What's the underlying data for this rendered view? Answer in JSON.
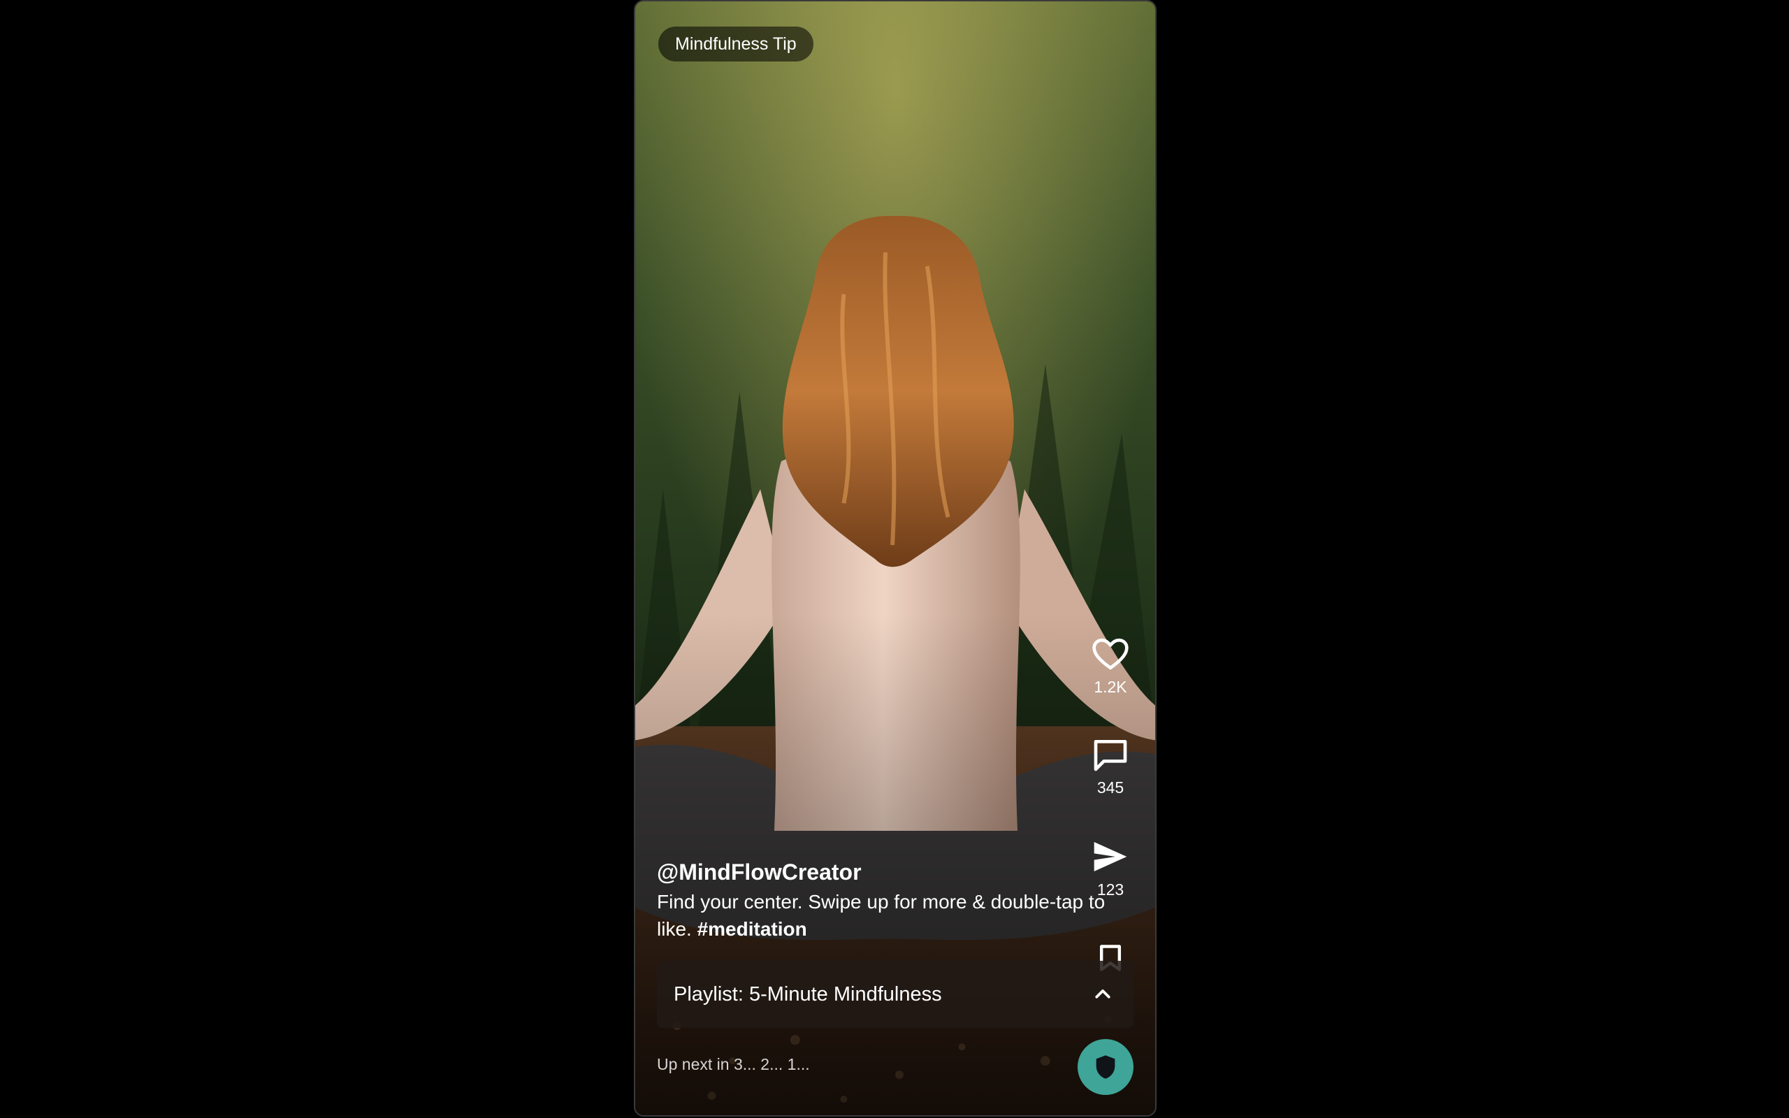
{
  "badge": "Mindfulness Tip",
  "post": {
    "handle": "@MindFlowCreator",
    "caption": "Find your center. Swipe up for more & double-tap to like.",
    "hashtag": "#meditation"
  },
  "actions": {
    "like_count": "1.2K",
    "comment_count": "345",
    "share_count": "123"
  },
  "playlist": {
    "title": "Playlist: 5-Minute Mindfulness"
  },
  "up_next": "Up next in 3... 2... 1...",
  "colors": {
    "fab": "#3ea598",
    "badge_bg": "rgba(0,0,0,0.55)",
    "playlist_bg": "rgba(34,26,22,0.86)"
  },
  "icons": [
    "heart-icon",
    "comment-icon",
    "send-icon",
    "bookmark-icon",
    "chevron-up-icon",
    "shield-icon"
  ]
}
